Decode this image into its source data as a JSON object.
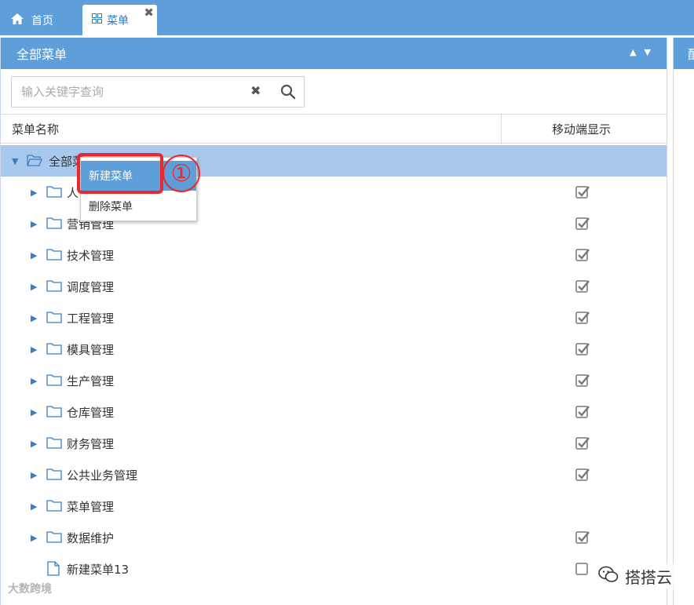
{
  "tabs": [
    {
      "label": "首页",
      "icon": "home-icon"
    },
    {
      "label": "菜单",
      "icon": "grid-icon"
    }
  ],
  "panel": {
    "title": "全部菜单",
    "right_panel_title_fragment": "配"
  },
  "search": {
    "placeholder": "输入关键字查询",
    "value": ""
  },
  "columns": {
    "name": "菜单名称",
    "mobile": "移动端显示"
  },
  "tree": {
    "root": {
      "label": "全部菜单",
      "visible_label": "全部菜",
      "expanded": true,
      "selected": true
    },
    "items": [
      {
        "label": "人事管理",
        "visible_label": "人",
        "type": "folder",
        "mobile": true
      },
      {
        "label": "营销管理",
        "visible_label": "营销管理",
        "type": "folder",
        "mobile": true
      },
      {
        "label": "技术管理",
        "visible_label": "技术管理",
        "type": "folder",
        "mobile": true
      },
      {
        "label": "调度管理",
        "visible_label": "调度管理",
        "type": "folder",
        "mobile": true
      },
      {
        "label": "工程管理",
        "visible_label": "工程管理",
        "type": "folder",
        "mobile": true
      },
      {
        "label": "模具管理",
        "visible_label": "模具管理",
        "type": "folder",
        "mobile": true
      },
      {
        "label": "生产管理",
        "visible_label": "生产管理",
        "type": "folder",
        "mobile": true
      },
      {
        "label": "仓库管理",
        "visible_label": "仓库管理",
        "type": "folder",
        "mobile": true
      },
      {
        "label": "财务管理",
        "visible_label": "财务管理",
        "type": "folder",
        "mobile": true
      },
      {
        "label": "公共业务管理",
        "visible_label": "公共业务管理",
        "type": "folder",
        "mobile": true
      },
      {
        "label": "菜单管理",
        "visible_label": "菜单管理",
        "type": "folder",
        "mobile": false
      },
      {
        "label": "数据维护",
        "visible_label": "数据维护",
        "type": "folder",
        "mobile": true
      },
      {
        "label": "新建菜单13",
        "visible_label": "新建菜单13",
        "type": "file",
        "mobile": false
      }
    ]
  },
  "context_menu": {
    "items": [
      "新建菜单",
      "删除菜单"
    ],
    "highlighted": "新建菜单"
  },
  "annotation": "①",
  "watermarks": {
    "left": "大数跨境",
    "right": "搭搭云"
  },
  "colors": {
    "header_blue": "#5e9ed9",
    "selected_row": "#a8c9ec",
    "annotation_red": "#e8282e"
  }
}
